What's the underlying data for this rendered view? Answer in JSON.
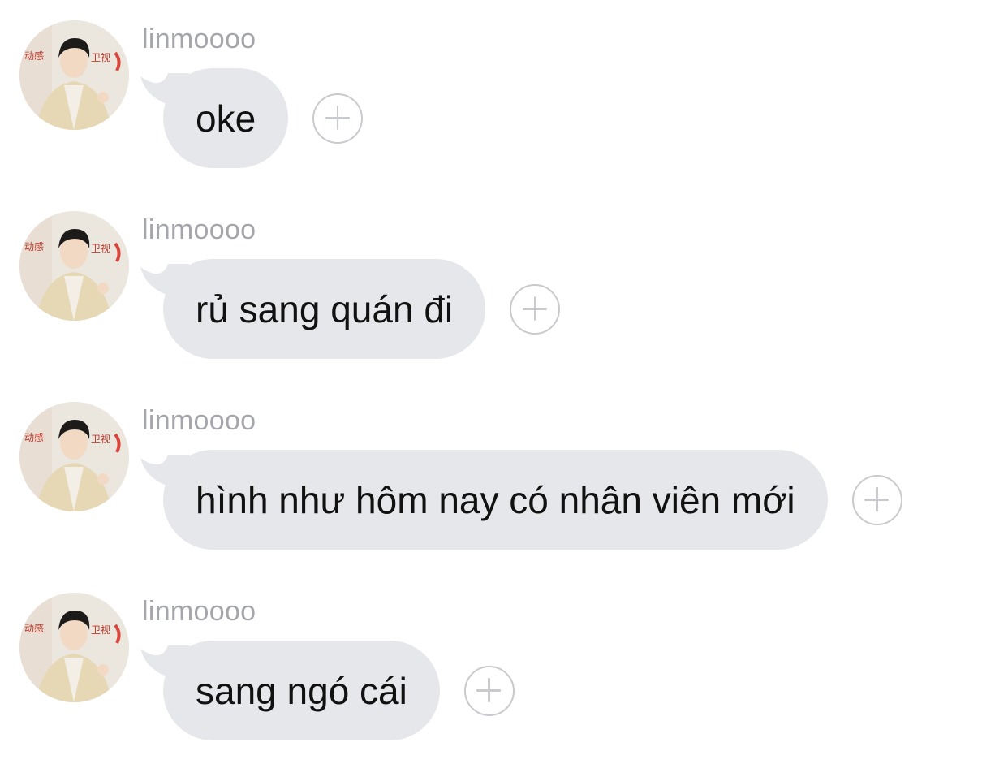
{
  "messages": [
    {
      "sender": "linmoooo",
      "text": "oke"
    },
    {
      "sender": "linmoooo",
      "text": "rủ sang quán đi"
    },
    {
      "sender": "linmoooo",
      "text": "hình như hôm nay có nhân viên mới"
    },
    {
      "sender": "linmoooo",
      "text": "sang ngó cái"
    }
  ],
  "icons": {
    "reaction": "plus-circle-icon",
    "avatar": "profile-photo"
  },
  "colors": {
    "bubble": "#e5e7ea",
    "sender": "#a4a6ab",
    "react_icon": "#c9cacd",
    "text": "#111111"
  }
}
